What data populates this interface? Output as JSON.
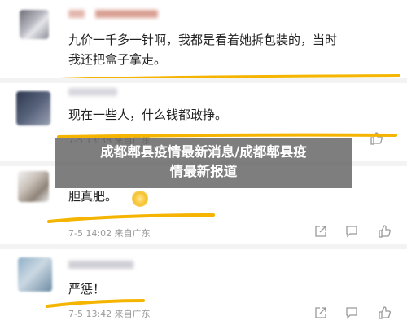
{
  "comments": [
    {
      "text_line1": "九价一千多一针啊，我都是看着她拆包装的，当时",
      "text_line2": "我还把盒子拿走。"
    },
    {
      "text": "现在一些人，什么钱都敢挣。",
      "meta": "7-5 13:38 来自广东"
    },
    {
      "text": "胆真肥。",
      "meta": "7-5 14:02 来自广东"
    },
    {
      "text": "严惩！",
      "meta": "7-5 13:42 来自广东"
    }
  ],
  "banner": {
    "line1": "成都郫县疫情最新消息/成都郫县疫",
    "line2": "情最新报道"
  },
  "colors": {
    "highlight": "#f5b400",
    "banner_bg": "#5a5a5a",
    "meta_text": "#9a9a9a"
  },
  "icons": [
    "share-icon",
    "comment-icon",
    "like-icon"
  ]
}
